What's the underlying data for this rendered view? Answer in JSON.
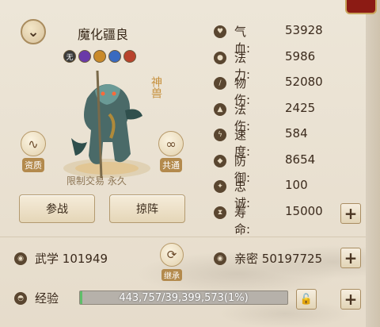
{
  "pet": {
    "name": "魔化疆良",
    "seal": "神兽",
    "restriction": "限制交易 永久",
    "badges": [
      "无",
      "",
      "",
      "",
      ""
    ]
  },
  "side_buttons": {
    "aptitude": "资质",
    "common": "共通"
  },
  "actions": {
    "fight": "参战",
    "formation": "掠阵",
    "inherit": "继承"
  },
  "stats": [
    {
      "name": "气血:",
      "value": "53928",
      "icon": "heart-icon"
    },
    {
      "name": "法力:",
      "value": "5986",
      "icon": "drop-icon"
    },
    {
      "name": "物伤:",
      "value": "52080",
      "icon": "sword-icon"
    },
    {
      "name": "法伤:",
      "value": "2425",
      "icon": "flame-icon"
    },
    {
      "name": "速度:",
      "value": "584",
      "icon": "lightning-icon"
    },
    {
      "name": "防御:",
      "value": "8654",
      "icon": "shield-icon"
    },
    {
      "name": "忠诚:",
      "value": "100",
      "icon": "loyalty-icon"
    },
    {
      "name": "寿命:",
      "value": "15000",
      "icon": "life-icon"
    }
  ],
  "bottom": {
    "martial_label": "武学",
    "martial_value": "101949",
    "intimacy_label": "亲密",
    "intimacy_value": "50197725",
    "exp_label": "经验",
    "exp_text": "443,757/39,399,573(1%)",
    "exp_fraction": 0.0113
  },
  "colors": {
    "background": "#e9e1d2",
    "accent_gold": "#b38a4d",
    "exp_fill": "#5fbf6a",
    "corner_red": "#8c1b14"
  }
}
